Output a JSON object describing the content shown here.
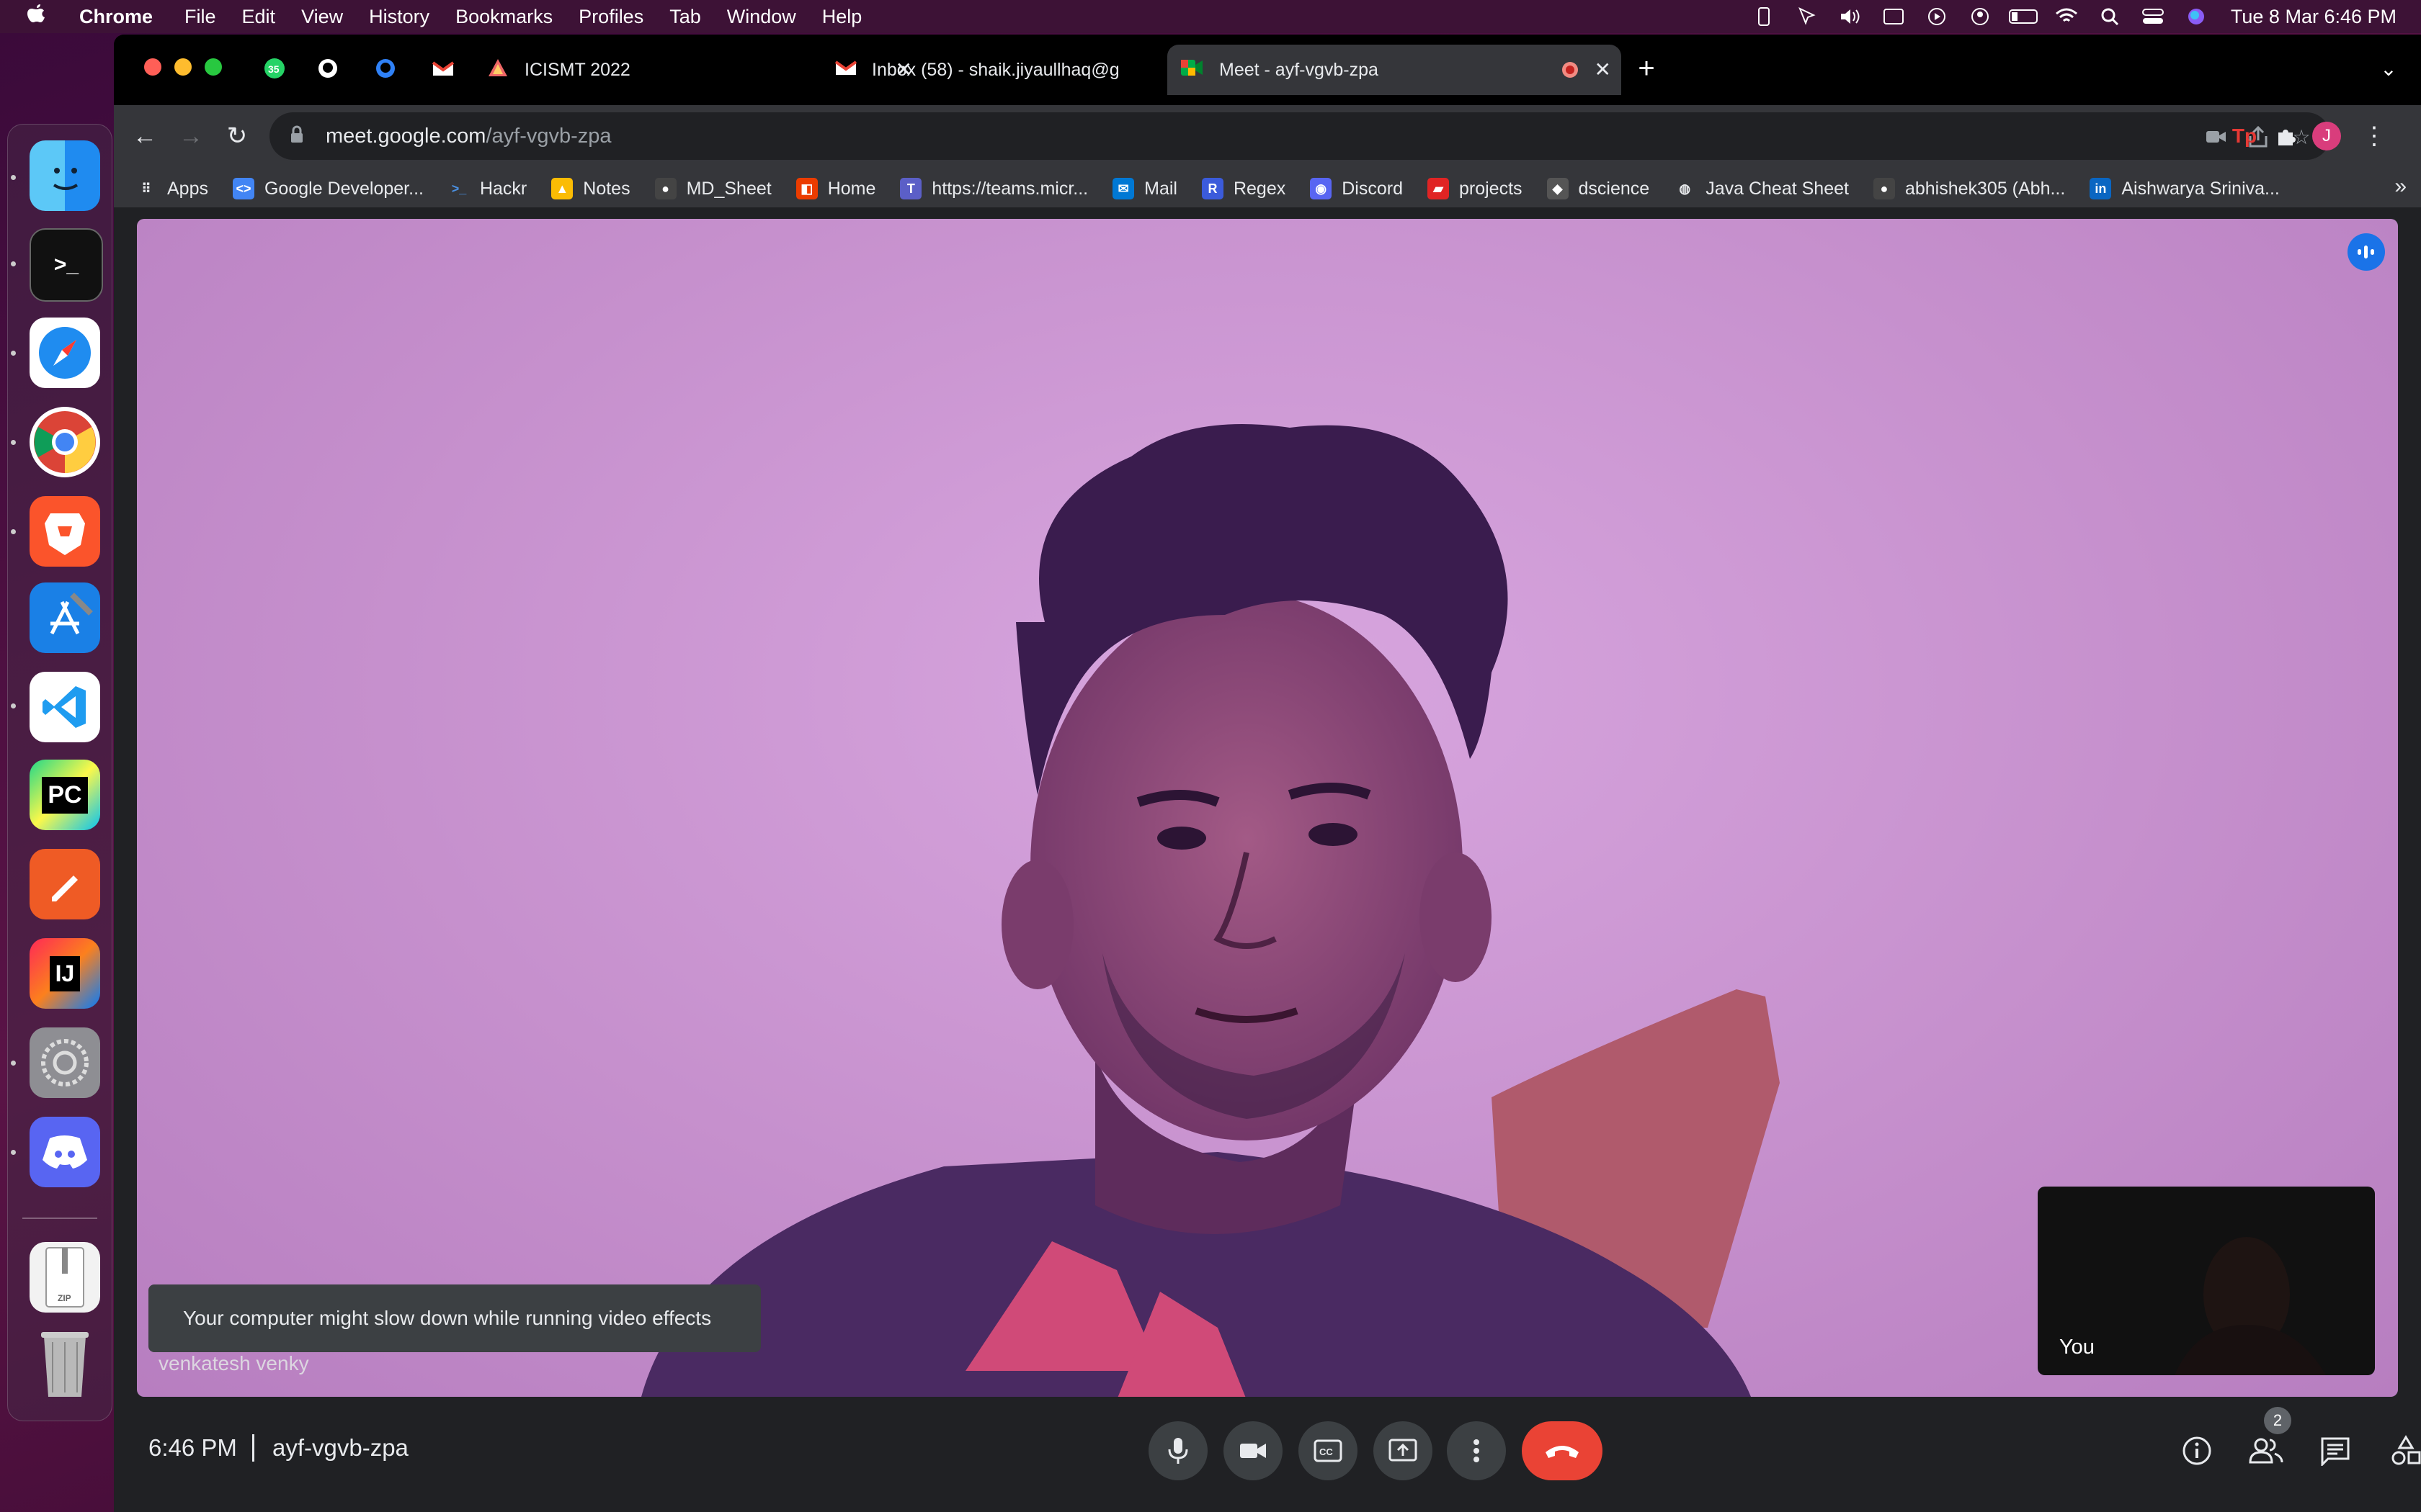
{
  "menubar": {
    "apple": "",
    "app": "Chrome",
    "items": [
      "File",
      "Edit",
      "View",
      "History",
      "Bookmarks",
      "Profiles",
      "Tab",
      "Window",
      "Help"
    ],
    "clock": "Tue 8 Mar  6:46 PM"
  },
  "tabs": [
    {
      "title": "ICISMT 2022"
    },
    {
      "title": "Inbox (58) - shaik.jiyaullhaq@g"
    },
    {
      "title": "Meet - ayf-vgvb-zpa"
    }
  ],
  "pinned_badge": "35",
  "address": {
    "host": "meet.google.com",
    "path": "/ayf-vgvb-zpa"
  },
  "profile_initial": "J",
  "bookmarks": [
    {
      "label": "Apps",
      "icon": "apps-grid-icon",
      "color": "#e8eaed"
    },
    {
      "label": "Google Developer...",
      "icon": "google-developers-icon",
      "color": "#4285f4"
    },
    {
      "label": "Hackr",
      "icon": "terminal-prompt-icon",
      "color": "#4a90e2"
    },
    {
      "label": "Notes",
      "icon": "drive-icon",
      "color": "#fbbc04"
    },
    {
      "label": "MD_Sheet",
      "icon": "github-icon",
      "color": "#444"
    },
    {
      "label": "Home",
      "icon": "office-icon",
      "color": "#eb3c00"
    },
    {
      "label": "https://teams.micr...",
      "icon": "teams-icon",
      "color": "#5b5fc7"
    },
    {
      "label": "Mail",
      "icon": "outlook-icon",
      "color": "#0078d4"
    },
    {
      "label": "Regex",
      "icon": "regex-r-icon",
      "color": "#3b5bdb"
    },
    {
      "label": "Discord",
      "icon": "discord-icon",
      "color": "#5865f2"
    },
    {
      "label": "projects",
      "icon": "projects-icon",
      "color": "#e02424"
    },
    {
      "label": "dscience",
      "icon": "dscience-icon",
      "color": "#555"
    },
    {
      "label": "Java Cheat Sheet",
      "icon": "globe-icon",
      "color": "#e8eaed"
    },
    {
      "label": "abhishek305 (Abh...",
      "icon": "github-icon",
      "color": "#444"
    },
    {
      "label": "Aishwarya Sriniva...",
      "icon": "linkedin-icon",
      "color": "#0a66c2"
    }
  ],
  "bookmarks_overflow": "»",
  "meet": {
    "participant_name": "venkatesh venky",
    "toast": "Your computer might slow down while running video effects",
    "self_label": "You",
    "time": "6:46 PM",
    "meeting_code": "ayf-vgvb-zpa",
    "participant_count": "2"
  },
  "colors": {
    "end_call": "#ea4335",
    "active_speaker": "#1a73e8",
    "meet_bg": "#202124"
  }
}
